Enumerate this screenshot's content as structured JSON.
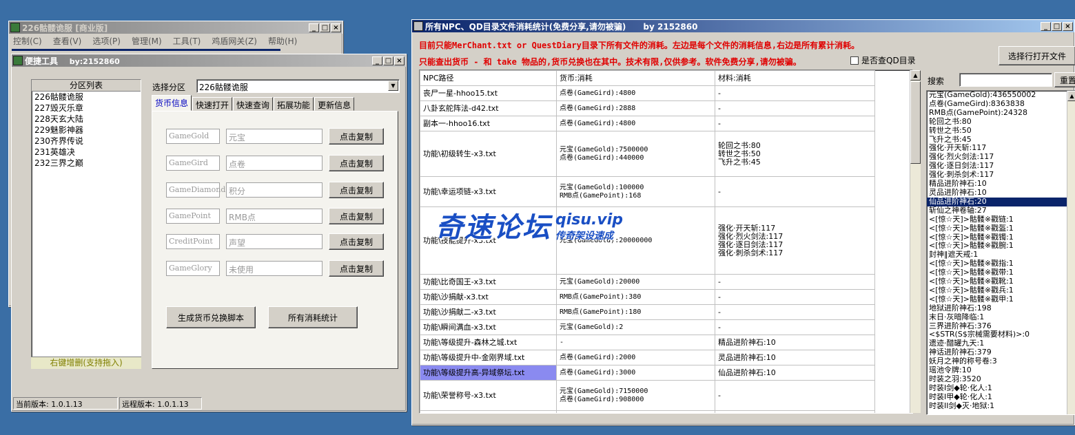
{
  "main_window": {
    "title": "226骷髅诡服 [商业版]",
    "menu": [
      "控制(C)",
      "查看(V)",
      "选项(P)",
      "管理(M)",
      "工具(T)",
      "鸡盾网关(Z)",
      "帮助(H)"
    ]
  },
  "tool_window": {
    "title": "便捷工具",
    "author": "by:2152860",
    "partition_header": "分区列表",
    "partitions": [
      "226骷髅诡服",
      "227毁灭乐章",
      "228天玄大陆",
      "229魅影神器",
      "230齐界传说",
      "231英雄决",
      "232三界之巅"
    ],
    "partition_footer": "右键增删(支持拖入)",
    "select_label": "选择分区",
    "select_value": "226骷髅诡服",
    "tabs": [
      "货币信息",
      "快速打开",
      "快速查询",
      "拓展功能",
      "更新信息"
    ],
    "currencies": [
      {
        "key": "GameGold",
        "name": "元宝",
        "button": "点击复制"
      },
      {
        "key": "GameGird",
        "name": "点卷",
        "button": "点击复制"
      },
      {
        "key": "GameDiamond",
        "name": "积分",
        "button": "点击复制"
      },
      {
        "key": "GamePoint",
        "name": "RMB点",
        "button": "点击复制"
      },
      {
        "key": "CreditPoint",
        "name": "声望",
        "button": "点击复制"
      },
      {
        "key": "GameGlory",
        "name": "未使用",
        "button": "点击复制"
      }
    ],
    "gen_button": "生成货币兑换脚本",
    "stats_button": "所有消耗统计",
    "status_current": "当前版本: 1.0.1.13",
    "status_remote": "远程版本: 1.0.1.13"
  },
  "stats_window": {
    "title": "所有NPC、QD目录文件消耗统计(免费分享,请勿被骗)",
    "author": "by 2152860",
    "notice1": "目前只能MerChant.txt or QuestDiary目录下所有文件的消耗。左边是每个文件的消耗信息,右边是所有累计消耗。",
    "notice2": "只能查出货币 - 和 take 物品的,货币兑换也在其中。技术有限,仅供参考。软件免费分享,请勿被骗。",
    "checkbox_label": "是否查QD目录",
    "select_open_button": "选择行打开文件",
    "search_label": "搜索",
    "reset_button": "重置",
    "columns": [
      "NPC路径",
      "货币:消耗",
      "材料:消耗"
    ],
    "rows": [
      {
        "path": "丧尸一星-hhoo15.txt",
        "cost": [
          "点卷(GameGird):4800"
        ],
        "mat": [
          "-"
        ]
      },
      {
        "path": "八卦玄舵阵法-d42.txt",
        "cost": [
          "点卷(GameGird):2888"
        ],
        "mat": [
          "-"
        ]
      },
      {
        "path": "副本一-hhoo16.txt",
        "cost": [
          "点卷(GameGird):4800"
        ],
        "mat": [
          "-"
        ]
      },
      {
        "path": "功能\\初级转生-x3.txt",
        "cost": [
          "元宝(GameGold):7500000",
          "点卷(GameGird):440000"
        ],
        "mat": [
          "轮回之书:80",
          "转世之书:50",
          "飞升之书:45"
        ]
      },
      {
        "path": "功能\\幸运项链-x3.txt",
        "cost": [
          "元宝(GameGold):100000",
          "RMB点(GamePoint):168"
        ],
        "mat": [
          "-"
        ]
      },
      {
        "path": "功能\\技能提升-x3.txt",
        "cost": [
          "元宝(GameGold):20000000"
        ],
        "mat": [
          "强化·开天斩:117",
          "强化·烈火剑法:117",
          "强化·逐日剑法:117",
          "强化·刺杀剑术:117"
        ]
      },
      {
        "path": "功能\\比奇国王-x3.txt",
        "cost": [
          "元宝(GameGold):20000"
        ],
        "mat": [
          "-"
        ]
      },
      {
        "path": "功能\\沙捐献-x3.txt",
        "cost": [
          "RMB点(GamePoint):380"
        ],
        "mat": [
          "-"
        ]
      },
      {
        "path": "功能\\沙捐献二-x3.txt",
        "cost": [
          "RMB点(GamePoint):180"
        ],
        "mat": [
          "-"
        ]
      },
      {
        "path": "功能\\瞬间满血-x3.txt",
        "cost": [
          "元宝(GameGold):2"
        ],
        "mat": [
          "-"
        ]
      },
      {
        "path": "功能\\等级提升-森林之城.txt",
        "cost": [
          "-"
        ],
        "mat": [
          "精品进阶神石:10"
        ]
      },
      {
        "path": "功能\\等级提升中-金刚界域.txt",
        "cost": [
          "点卷(GameGird):2000"
        ],
        "mat": [
          "灵品进阶神石:10"
        ]
      },
      {
        "path": "功能\\等级提升高-异域祭坛.txt",
        "cost": [
          "点卷(GameGird):3000"
        ],
        "mat": [
          "仙品进阶神石:10"
        ]
      },
      {
        "path": "功能\\荣誉称号-x3.txt",
        "cost": [
          "元宝(GameGold):7150000",
          "点卷(GameGird):908000"
        ],
        "mat": [
          "-"
        ]
      },
      {
        "path": "",
        "cost": [
          "元宝(GameGold):7150000"
        ],
        "mat": [
          ""
        ]
      }
    ],
    "totals": [
      "元宝(GameGold):436550002",
      "点卷(GameGird):8363838",
      "RMB点(GamePoint):24328",
      "轮回之书:80",
      "转世之书:50",
      "飞升之书:45",
      "强化·开天斩:117",
      "强化·烈火剑法:117",
      "强化·逐日剑法:117",
      "强化·刺杀剑术:117",
      "精品进阶神石:10",
      "灵品进阶神石:10",
      "仙品进阶神石:20",
      "斩仙之神卷轴:27",
      "<[惊☆天]>骷髅※戳链:1",
      "<[惊☆天]>骷髅※戳盔:1",
      "<[惊☆天]>骷髅※戳镯:1",
      "<[惊☆天]>骷髅※戳腕:1",
      "封神‖遮天戒:1",
      "<[惊☆天]>骷髅※戳指:1",
      "<[惊☆天]>骷髅※戳带:1",
      "<[惊☆天]>骷髅※戳靴:1",
      "<[惊☆天]>骷髅※戳兵:1",
      "<[惊☆天]>骷髅※戳甲:1",
      "地狱进阶神石:198",
      "末日·灰暗降临:1",
      "三界进阶神石:376",
      "<$STR(S$宗械需要材料)>:0",
      "遗迹·醋罐九天:1",
      "神话进阶神石:379",
      "妖月之神的称号卷:3",
      "瑶池令牌:10",
      "时装之羽:3520",
      "时装I剑◆轮·化人:1",
      "时装I甲◆轮·化人:1",
      "时装II剑◆灭·地狱:1"
    ],
    "selected_total_index": 12,
    "highlighted_row_index": 12
  },
  "watermark": {
    "cn": "奇速论坛",
    "domain": "qisu.vip",
    "sub": "传奇架设速成"
  },
  "colors": {
    "title_active": "#0a246a",
    "notice_red": "#e00000",
    "selection": "#0a246a",
    "row_highlight": "#8a8af0",
    "watermark": "#1a4fc4"
  }
}
